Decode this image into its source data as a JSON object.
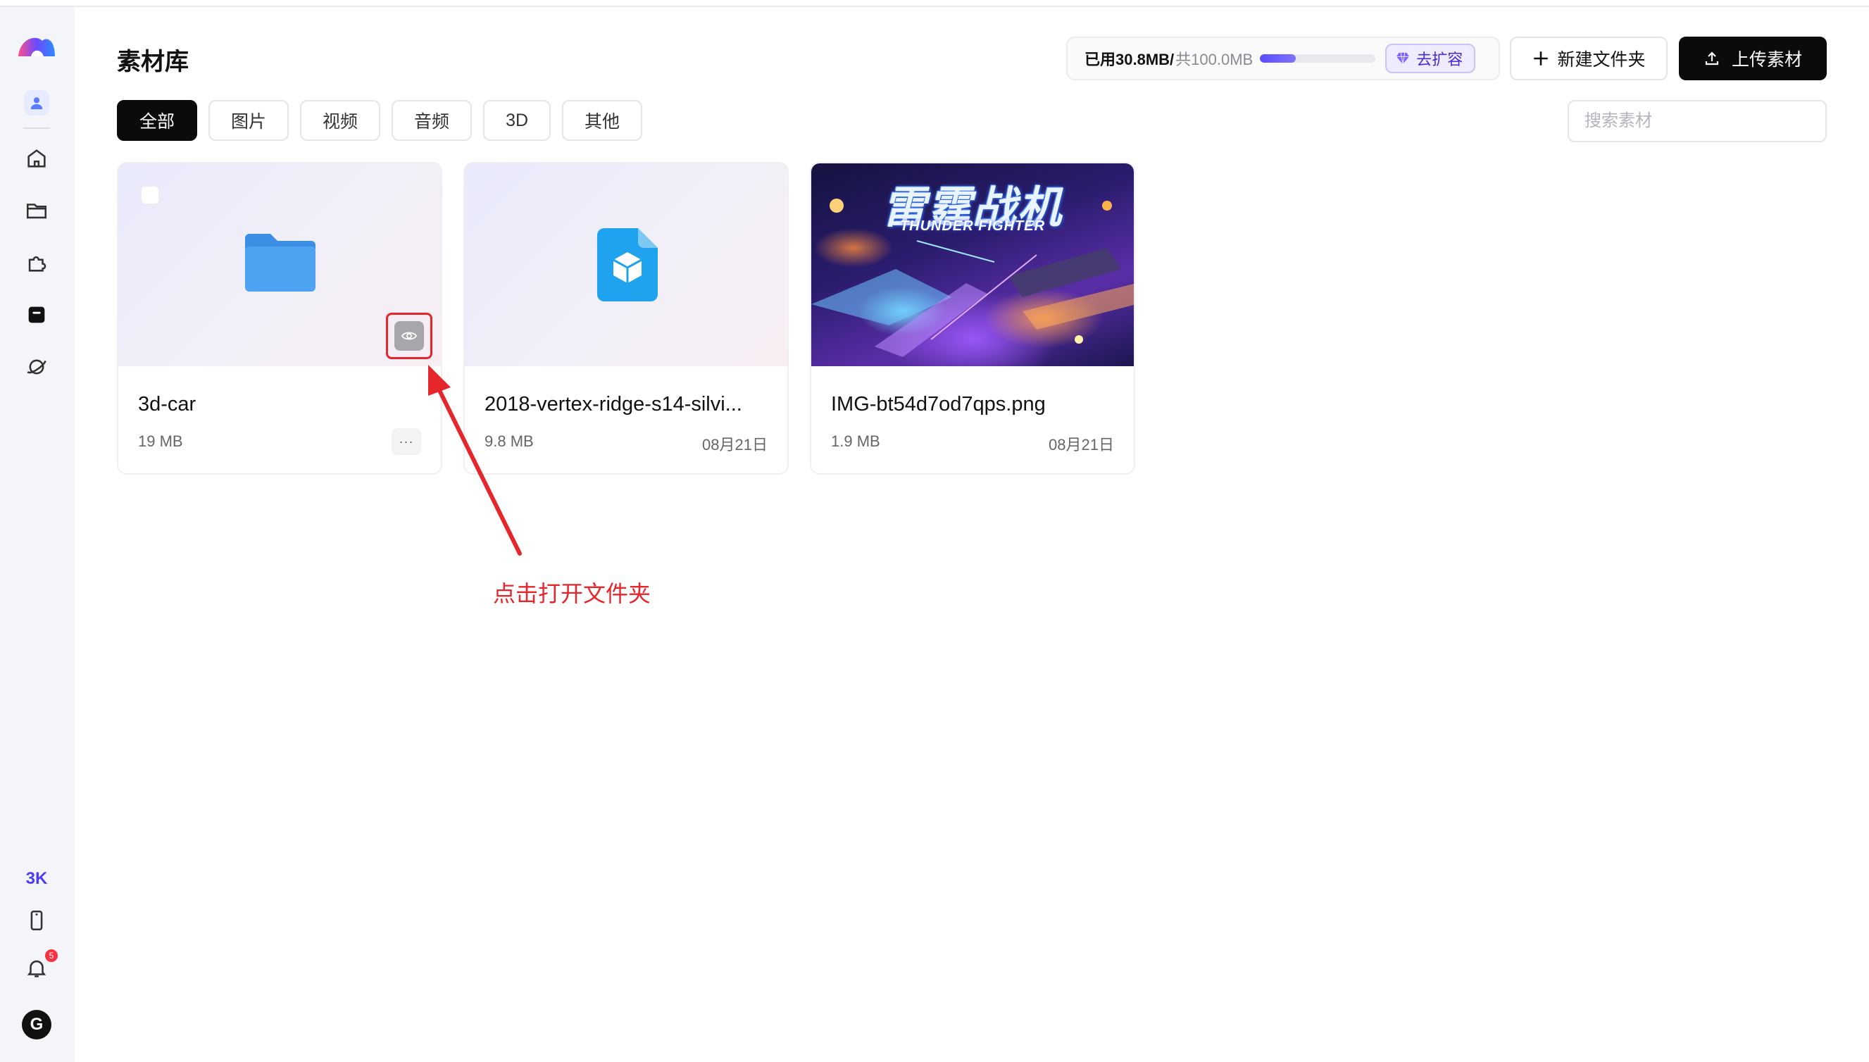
{
  "page": {
    "title": "素材库"
  },
  "storage": {
    "used": "已用30.8MB/",
    "total": "共100.0MB",
    "progress": 0.308,
    "expand_label": "去扩容"
  },
  "actions": {
    "new_folder": "新建文件夹",
    "upload": "上传素材"
  },
  "tabs": [
    {
      "label": "全部",
      "active": true
    },
    {
      "label": "图片",
      "active": false
    },
    {
      "label": "视频",
      "active": false
    },
    {
      "label": "音频",
      "active": false
    },
    {
      "label": "3D",
      "active": false
    },
    {
      "label": "其他",
      "active": false
    }
  ],
  "search": {
    "placeholder": "搜索素材",
    "value": ""
  },
  "cards": [
    {
      "name": "3d-car",
      "size": "19 MB",
      "date": "",
      "kind": "folder",
      "more": "···"
    },
    {
      "name": "2018-vertex-ridge-s14-silvi...",
      "size": "9.8 MB",
      "date": "08月21日",
      "kind": "3d-file"
    },
    {
      "name": "IMG-bt54d7od7qps.png",
      "size": "1.9 MB",
      "date": "08月21日",
      "kind": "image",
      "image_text": {
        "title": "雷霆战机",
        "subtitle": "THUNDER FIGHTER"
      }
    }
  ],
  "sidebar": {
    "items": [
      "logo",
      "profile-icon",
      "home-icon",
      "folder-icon",
      "plugin-icon",
      "library-icon",
      "planet-icon"
    ],
    "bottom": {
      "badge": "3K",
      "notifications": "5",
      "user_initial": "G"
    }
  },
  "annotation": {
    "text": "点击打开文件夹",
    "color": "#e5262b"
  },
  "colors": {
    "accent": "#5b4bff",
    "primary_button": "#0b0b0b",
    "annotation_red": "#e5262b"
  }
}
